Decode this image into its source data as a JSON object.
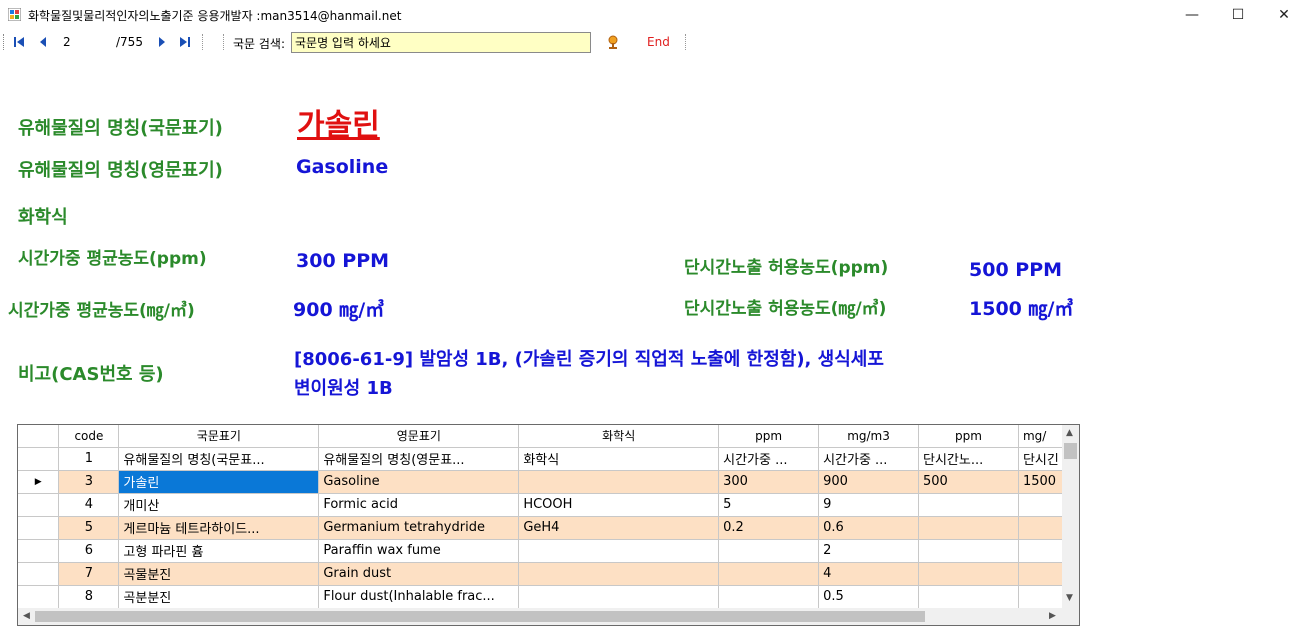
{
  "window": {
    "title": "화학물질및물리적인자의노출기준    응용개발자 :man3514@hanmail.net",
    "minimize": "—",
    "maximize": "☐",
    "close": "✕"
  },
  "toolbar": {
    "position": "2",
    "total": "/755",
    "search_label": "국문 검색:",
    "search_value": "국문명 입력 하세요",
    "end_label": "End"
  },
  "info": {
    "label_name_kr": "유해물질의  명칭(국문표기)",
    "name_kr": "가솔린",
    "label_name_en": "유해물질의  명칭(영문표기)",
    "name_en": "Gasoline",
    "label_formula": "화학식",
    "formula": "",
    "label_twa_ppm": "시간가중  평균농도(ppm)",
    "twa_ppm": "300 PPM",
    "label_stel_ppm": "단시간노출  허용농도(ppm)",
    "stel_ppm": "500  PPM",
    "label_twa_mg": "시간가중  평균농도(㎎/㎥)",
    "twa_mg": "900 ㎎/㎥",
    "label_stel_mg": "단시간노출  허용농도(㎎/㎥)",
    "stel_mg": "1500  ㎎/㎥",
    "label_remark": "비고(CAS번호  등)",
    "remark_line1": "[8006-61-9] 발암성 1B, (가솔린 증기의 직업적 노출에 한정함), 생식세포",
    "remark_line2": "변이원성 1B"
  },
  "grid": {
    "columns": [
      "code",
      "국문표기",
      "영문표기",
      "화학식",
      "ppm",
      "mg/m3",
      "ppm",
      "mg/"
    ],
    "rows": [
      {
        "code": "1",
        "kr": "유해물질의 명칭(국문표...",
        "en": "유해물질의 명칭(영문표...",
        "formula": "화학식",
        "ppm": "시간가중 ...",
        "mg": "시간가중 ...",
        "ppm2": "단시간노...",
        "mg2": "단시긴"
      },
      {
        "code": "3",
        "kr": "가솔린",
        "en": "Gasoline",
        "formula": "",
        "ppm": "300",
        "mg": "900",
        "ppm2": "500",
        "mg2": "1500"
      },
      {
        "code": "4",
        "kr": "개미산",
        "en": "Formic acid",
        "formula": "HCOOH",
        "ppm": "5",
        "mg": "9",
        "ppm2": "",
        "mg2": ""
      },
      {
        "code": "5",
        "kr": "게르마늄 테트라하이드...",
        "en": "Germanium tetrahydride",
        "formula": "GeH4",
        "ppm": "0.2",
        "mg": "0.6",
        "ppm2": "",
        "mg2": ""
      },
      {
        "code": "6",
        "kr": "고형 파라핀 흄",
        "en": "Paraffin wax fume",
        "formula": "",
        "ppm": "",
        "mg": "2",
        "ppm2": "",
        "mg2": ""
      },
      {
        "code": "7",
        "kr": "곡물분진",
        "en": "Grain dust",
        "formula": "",
        "ppm": "",
        "mg": "4",
        "ppm2": "",
        "mg2": ""
      },
      {
        "code": "8",
        "kr": "곡분분진",
        "en": "Flour dust(Inhalable frac...",
        "formula": "",
        "ppm": "",
        "mg": "0.5",
        "ppm2": "",
        "mg2": ""
      }
    ],
    "current_row_marker": "▶"
  },
  "icons": {
    "first": "first-record-icon",
    "prev": "prev-record-icon",
    "next": "next-record-icon",
    "last": "last-record-icon",
    "search": "search-go-icon"
  },
  "colors": {
    "label_green": "#2b8a2b",
    "value_blue": "#1515d6",
    "name_red": "#e01010",
    "row_alt": "#fde0c4",
    "selection": "#0a78d7",
    "search_bg": "#ffffc4"
  }
}
